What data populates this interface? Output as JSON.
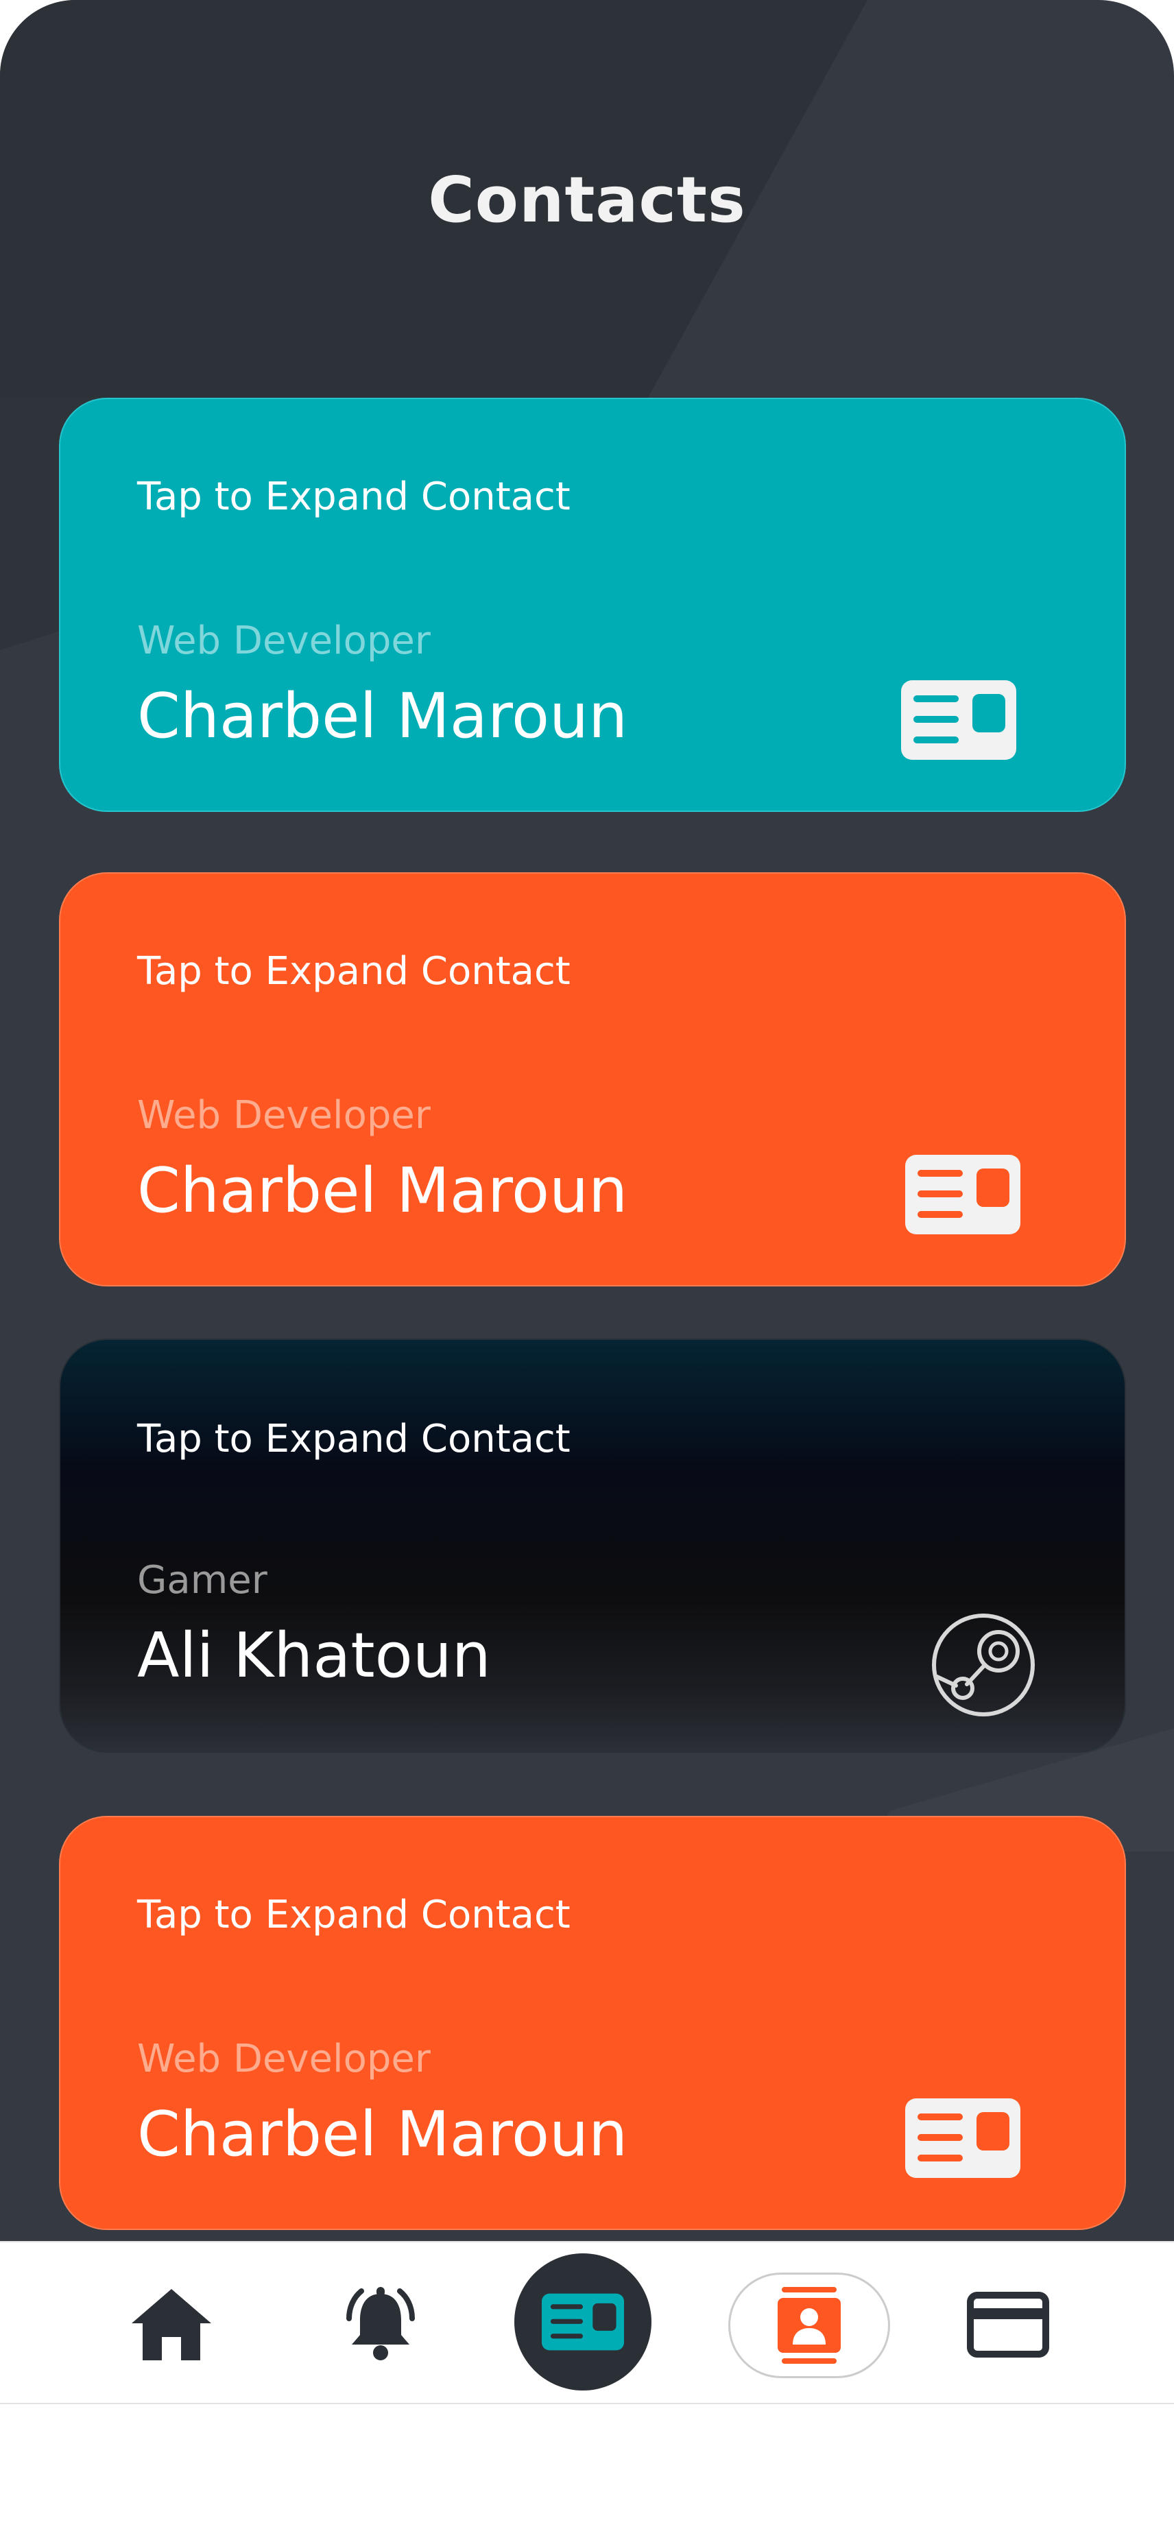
{
  "header": {
    "title": "Contacts"
  },
  "contacts": [
    {
      "hint": "Tap to Expand Contact",
      "role": "Web Developer",
      "name": "Charbel Maroun",
      "icon": "id-card-icon",
      "color": "#00adb5"
    },
    {
      "hint": "Tap to Expand Contact",
      "role": "Web Developer",
      "name": "Charbel Maroun",
      "icon": "id-card-icon",
      "color": "#ff5722"
    },
    {
      "hint": "Tap to Expand Contact",
      "role": "Gamer",
      "name": "Ali Khatoun",
      "icon": "steam-icon",
      "color": "#0d0d0f"
    },
    {
      "hint": "Tap to Expand Contact",
      "role": "Web Developer",
      "name": "Charbel Maroun",
      "icon": "id-card-icon",
      "color": "#ff5722"
    }
  ],
  "nav": {
    "items": [
      {
        "icon": "home-icon",
        "active": false
      },
      {
        "icon": "bell-icon",
        "active": false
      },
      {
        "icon": "id-card-icon",
        "active": true
      },
      {
        "icon": "contacts-book-icon",
        "active": false
      },
      {
        "icon": "credit-card-icon",
        "active": false
      }
    ]
  },
  "colors": {
    "accent_teal": "#00adb5",
    "accent_orange": "#ff5722",
    "dark": "#2b2f36",
    "background": "#353a42"
  }
}
